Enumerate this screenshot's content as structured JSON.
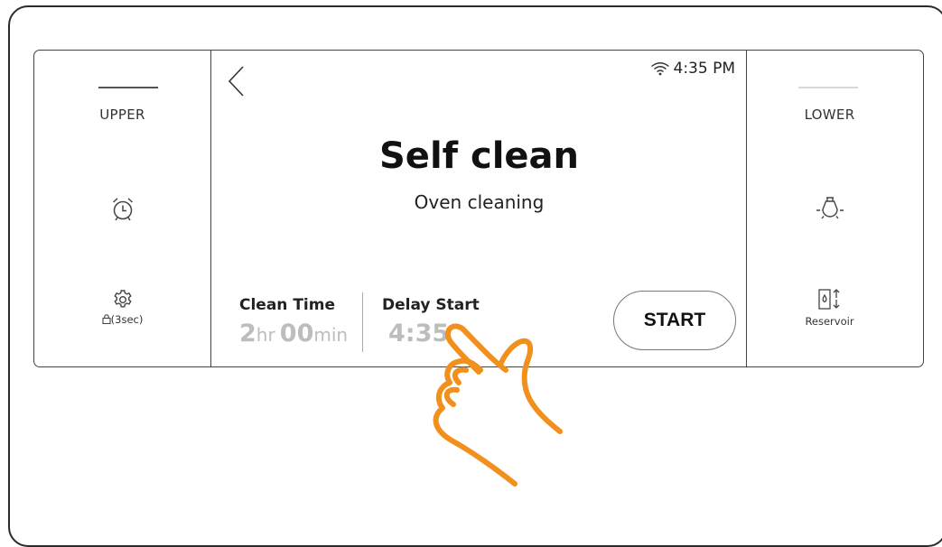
{
  "status": {
    "time": "4:35 PM",
    "wifi_icon": "wifi-icon"
  },
  "left_panel": {
    "cavity_label": "UPPER",
    "timer_icon": "alarm-clock-icon",
    "settings_icon": "gear-icon",
    "lock_hint": "(3sec)",
    "lock_icon": "lock-icon"
  },
  "right_panel": {
    "cavity_label": "LOWER",
    "light_icon": "oven-light-icon",
    "reservoir_icon": "water-reservoir-icon",
    "reservoir_label": "Reservoir"
  },
  "main": {
    "back_icon": "chevron-left-icon",
    "title": "Self clean",
    "subtitle": "Oven cleaning",
    "clean_time": {
      "label": "Clean Time",
      "hours": "2",
      "hours_unit": "hr",
      "minutes": "00",
      "minutes_unit": "min"
    },
    "delay_start": {
      "label": "Delay Start",
      "value": "4:35"
    },
    "start_label": "START"
  },
  "overlay": {
    "hand_icon": "tap-hand-icon"
  },
  "colors": {
    "hand": "#f2901e",
    "border": "#444444",
    "inactive_text": "#bdbdbd"
  }
}
